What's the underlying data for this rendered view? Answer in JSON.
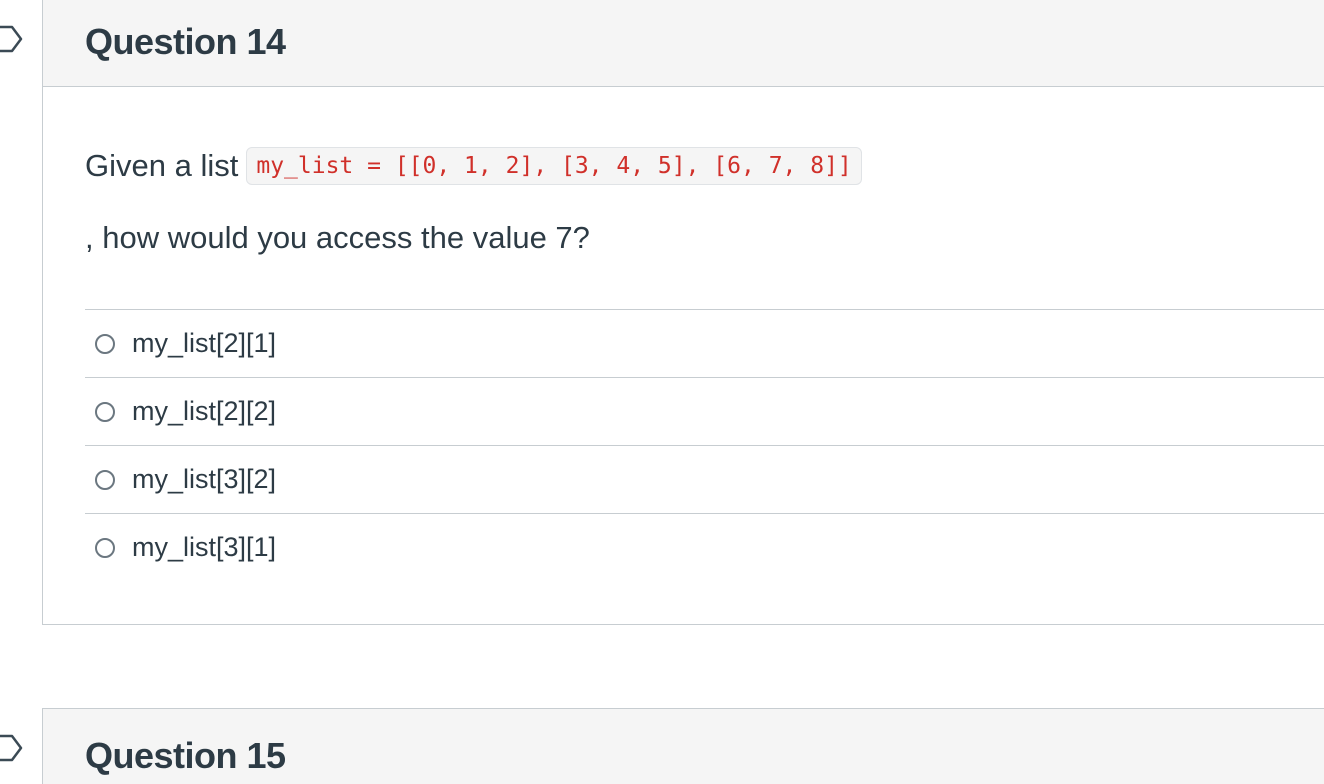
{
  "questions": [
    {
      "title": "Question 14",
      "prompt_before": "Given a list",
      "code": "my_list = [[0, 1, 2], [3, 4, 5], [6, 7, 8]]",
      "prompt_after": ", how would you access the value 7?",
      "answers": [
        {
          "label": "my_list[2][1]",
          "selected": false
        },
        {
          "label": "my_list[2][2]",
          "selected": false
        },
        {
          "label": "my_list[3][2]",
          "selected": false
        },
        {
          "label": "my_list[3][1]",
          "selected": false
        }
      ]
    },
    {
      "title": "Question 15"
    }
  ],
  "icons": {
    "flag": "bookmark-flag-icon",
    "radio": "radio-unselected-icon"
  },
  "colors": {
    "header_bg": "#f5f5f5",
    "border": "#c7cdd1",
    "text": "#2d3b45",
    "code_text": "#d0302a",
    "code_bg": "#f5f5f5"
  }
}
